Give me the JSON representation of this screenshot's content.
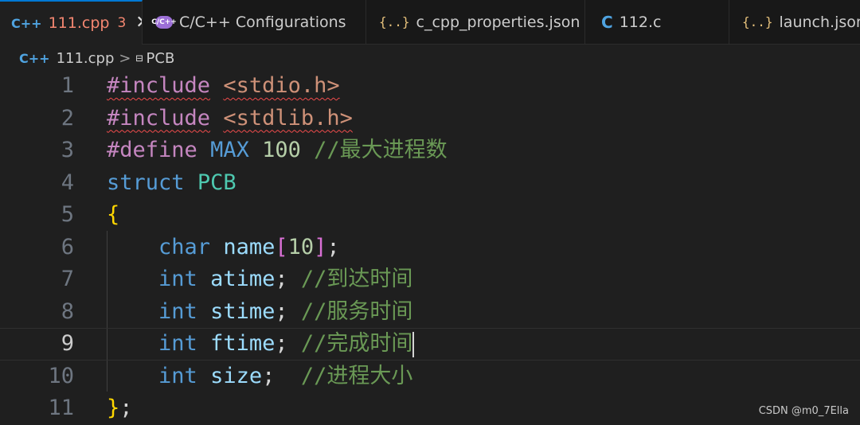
{
  "tabs": [
    {
      "icon": "C++",
      "label": "111.cpp",
      "badge": "3",
      "close": "✕",
      "active": true
    },
    {
      "icon": "C/C++",
      "label": "C/C++ Configurations"
    },
    {
      "icon": "{..}",
      "label": "c_cpp_properties.json"
    },
    {
      "icon": "C",
      "label": "112.c"
    },
    {
      "icon": "{..}",
      "label": "launch.json"
    }
  ],
  "breadcrumb": {
    "file_icon": "C++",
    "file": "111.cpp",
    "separator": ">",
    "symbol_icon": "⊟",
    "symbol": "PCB"
  },
  "lines": [
    {
      "n": "1",
      "parts": [
        [
          "#include",
          "kw-pre squig"
        ],
        [
          " ",
          ""
        ],
        [
          "<stdio.h>",
          "str squig"
        ]
      ]
    },
    {
      "n": "2",
      "parts": [
        [
          "#include",
          "kw-pre squig"
        ],
        [
          " ",
          ""
        ],
        [
          "<stdlib.h>",
          "str squig"
        ]
      ]
    },
    {
      "n": "3",
      "parts": [
        [
          "#define",
          "kw-pre"
        ],
        [
          " ",
          ""
        ],
        [
          "MAX",
          "macro"
        ],
        [
          " ",
          ""
        ],
        [
          "100",
          "num"
        ],
        [
          " ",
          ""
        ],
        [
          "//最大进程数",
          "cmt"
        ]
      ]
    },
    {
      "n": "4",
      "parts": [
        [
          "struct",
          "kw"
        ],
        [
          " ",
          ""
        ],
        [
          "PCB",
          "type"
        ]
      ]
    },
    {
      "n": "5",
      "parts": [
        [
          "{",
          "brace"
        ]
      ]
    },
    {
      "n": "6",
      "parts": [
        [
          "    ",
          ""
        ],
        [
          "char",
          "kw"
        ],
        [
          " ",
          ""
        ],
        [
          "name",
          "var"
        ],
        [
          "[",
          "brk"
        ],
        [
          "10",
          "num"
        ],
        [
          "]",
          "brk"
        ],
        [
          ";",
          ""
        ]
      ]
    },
    {
      "n": "7",
      "parts": [
        [
          "    ",
          ""
        ],
        [
          "int",
          "kw"
        ],
        [
          " ",
          ""
        ],
        [
          "atime",
          "var"
        ],
        [
          "; ",
          ""
        ],
        [
          "//到达时间",
          "cmt"
        ]
      ]
    },
    {
      "n": "8",
      "parts": [
        [
          "    ",
          ""
        ],
        [
          "int",
          "kw"
        ],
        [
          " ",
          ""
        ],
        [
          "stime",
          "var"
        ],
        [
          "; ",
          ""
        ],
        [
          "//服务时间",
          "cmt"
        ]
      ]
    },
    {
      "n": "9",
      "parts": [
        [
          "    ",
          ""
        ],
        [
          "int",
          "kw"
        ],
        [
          " ",
          ""
        ],
        [
          "ftime",
          "var"
        ],
        [
          "; ",
          ""
        ],
        [
          "//完成时间",
          "cmt"
        ]
      ],
      "current": true
    },
    {
      "n": "10",
      "parts": [
        [
          "    ",
          ""
        ],
        [
          "int",
          "kw"
        ],
        [
          " ",
          ""
        ],
        [
          "size",
          "var"
        ],
        [
          ";  ",
          ""
        ],
        [
          "//进程大小",
          "cmt"
        ]
      ]
    },
    {
      "n": "11",
      "parts": [
        [
          "}",
          "brace"
        ],
        [
          ";",
          ""
        ]
      ]
    }
  ],
  "watermark": "CSDN @m0_7Ella"
}
